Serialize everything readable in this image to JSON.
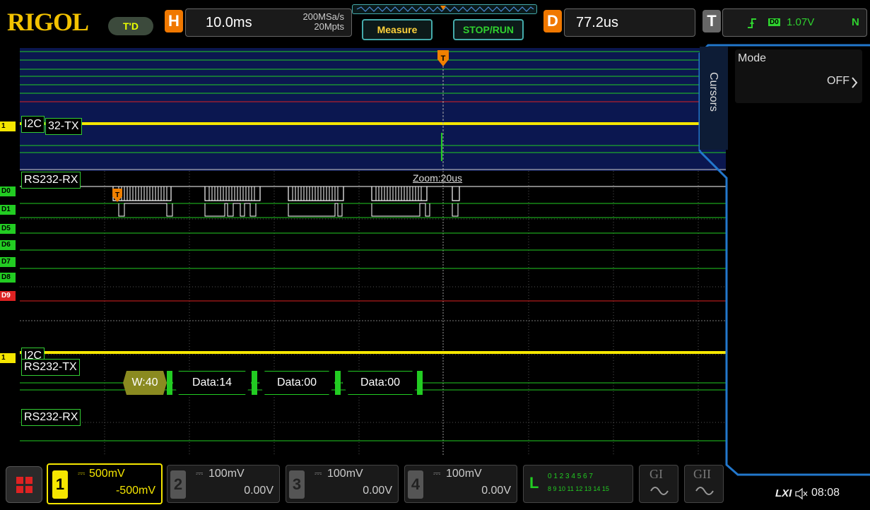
{
  "brand": "RIGOL",
  "trigger_state": "T'D",
  "horizontal": {
    "letter": "H",
    "timebase": "10.0ms",
    "sample_rate": "200MSa/s",
    "memory_depth": "20Mpts"
  },
  "toolbar": {
    "measure_label": "Measure",
    "stop_run_label": "STOP/RUN"
  },
  "delay": {
    "letter": "D",
    "value": "77.2us"
  },
  "trigger": {
    "letter": "T",
    "source": "D0",
    "level": "1.07V",
    "mode": "N"
  },
  "cursors": {
    "tab_label": "Cursors",
    "mode_label": "Mode",
    "mode_value": "OFF"
  },
  "waveform": {
    "upper": {
      "ch_marker": "1",
      "bus_label": "I2C",
      "tx_label": "32-TX",
      "rx_label": "RS232-RX",
      "zoom_label": "Zoom:20us"
    },
    "digital_channels": [
      "D0",
      "D1",
      "D5",
      "D6",
      "D7",
      "D8",
      "D9"
    ],
    "lower": {
      "ch_marker": "1",
      "bus_label": "I2C",
      "tx_label": "RS232-TX",
      "rx_label": "RS232-RX"
    },
    "decode_packets": [
      "W:40",
      "Data:14",
      "Data:00",
      "Data:00"
    ]
  },
  "channels": [
    {
      "num": "1",
      "scale": "500mV",
      "offset": "-500mV",
      "color": "#f5e600"
    },
    {
      "num": "2",
      "scale": "100mV",
      "offset": "0.00V",
      "color": "#888888"
    },
    {
      "num": "3",
      "scale": "100mV",
      "offset": "0.00V",
      "color": "#888888"
    },
    {
      "num": "4",
      "scale": "100mV",
      "offset": "0.00V",
      "color": "#888888"
    }
  ],
  "logic": {
    "letter": "L",
    "row1": "0 1 2 3 4 5 6 7",
    "row2": "8 9 10 11 12 13 14 15"
  },
  "generators": {
    "g1": "GI",
    "g2": "GII"
  },
  "status": {
    "lxi": "LXI",
    "time": "08:08"
  },
  "colors": {
    "ch1": "#f5e600",
    "digital": "#22cc22",
    "accent_cyan": "#2277cc",
    "red_channel": "#dd2222",
    "trigger_orange": "#f08000"
  }
}
